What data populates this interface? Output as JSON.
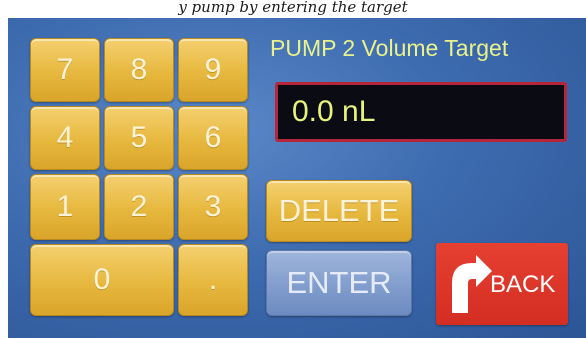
{
  "caption": "y pump by entering the target",
  "title": "PUMP 2 Volume Target",
  "display_value": "0.0 nL",
  "keypad": {
    "k7": "7",
    "k8": "8",
    "k9": "9",
    "k4": "4",
    "k5": "5",
    "k6": "6",
    "k1": "1",
    "k2": "2",
    "k3": "3",
    "k0": "0",
    "dot": "."
  },
  "buttons": {
    "delete": "DELETE",
    "enter": "ENTER",
    "back": "BACK"
  },
  "colors": {
    "background": "#3e6cb0",
    "key": "#e7b83e",
    "enter": "#7f9bcc",
    "back": "#d42e22",
    "title_text": "#e9f28c",
    "display_border": "#b5263a"
  },
  "icons": {
    "back": "curved-arrow-icon"
  }
}
